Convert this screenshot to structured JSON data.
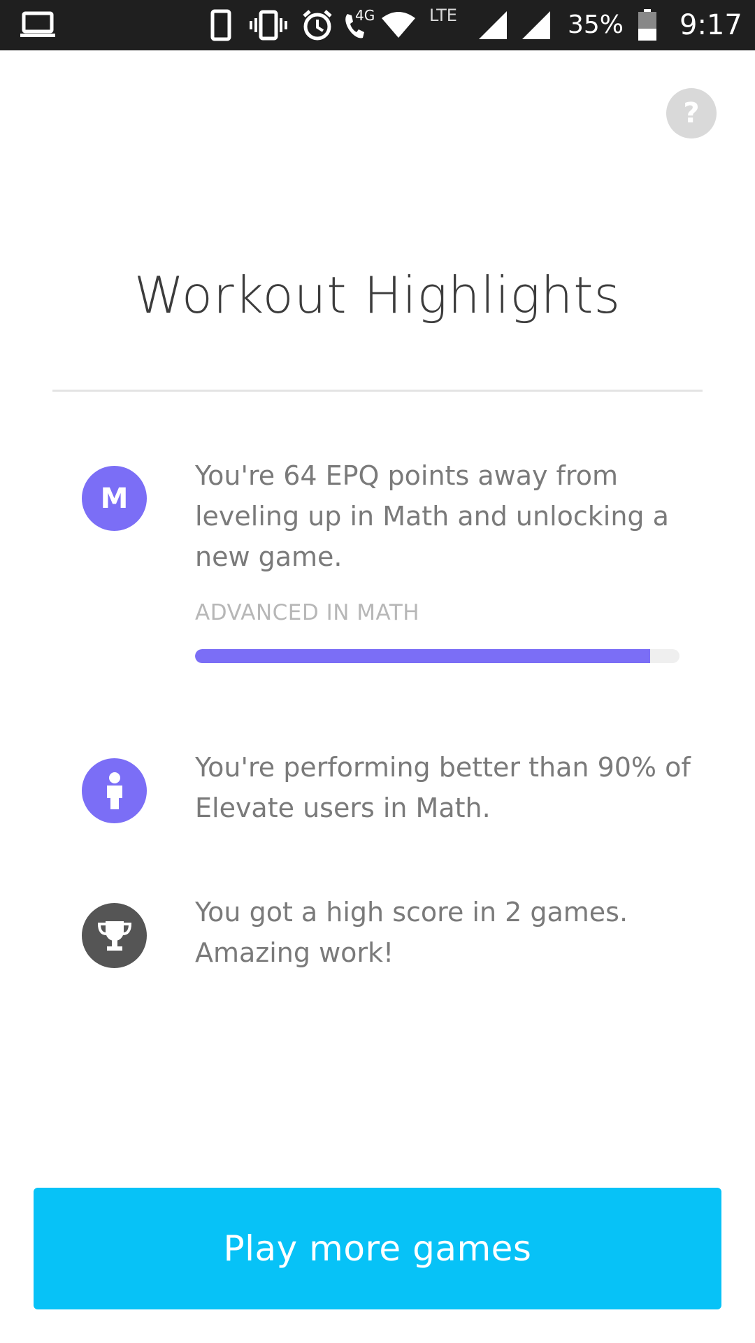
{
  "status_bar": {
    "network_4g": "4G",
    "network_lte": "LTE",
    "battery_percent": "35%",
    "time": "9:17",
    "icons": [
      "laptop-icon",
      "phone-icon",
      "vibrate-icon",
      "alarm-icon",
      "wifi-calling-icon",
      "wifi-icon",
      "signal-icon",
      "battery-icon"
    ]
  },
  "help": {
    "label": "?",
    "icon": "help-icon"
  },
  "page": {
    "title": "Workout Highlights"
  },
  "highlights": [
    {
      "icon_label": "M",
      "icon": "math-badge-icon",
      "text": "You're 64 EPQ points away from leveling up in Math and unlocking a new game.",
      "progress_label": "ADVANCED IN MATH",
      "progress_fraction": 0.94
    },
    {
      "icon": "person-icon",
      "text": "You're performing better than 90% of Elevate users in Math."
    },
    {
      "icon": "trophy-icon",
      "text": "You got a high score in 2 games. Amazing work!"
    }
  ],
  "cta": {
    "label": "Play more games"
  },
  "colors": {
    "accent_purple": "#7b6ef6",
    "trophy_gray": "#555555",
    "cta_blue": "#07c2f7",
    "status_bar": "#1f1f1f"
  }
}
